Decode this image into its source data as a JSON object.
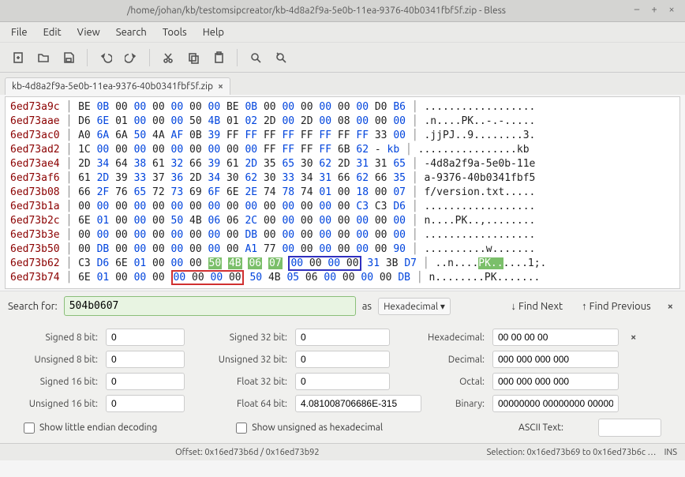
{
  "window": {
    "title": "/home/johan/kb/testomsipcreator/kb-4d8a2f9a-5e0b-11ea-9376-40b0341fbf5f.zip - Bless"
  },
  "menu": [
    "File",
    "Edit",
    "View",
    "Search",
    "Tools",
    "Help"
  ],
  "tab": {
    "label": "kb-4d8a2f9a-5e0b-11ea-9376-40b0341fbf5f.zip"
  },
  "hex": {
    "rows": [
      {
        "off": "6ed73a9c",
        "bytes": [
          "BE",
          "0B",
          "00",
          "00",
          "00",
          "00",
          "00",
          "00",
          "BE",
          "0B",
          "00",
          "00",
          "00",
          "00",
          "00",
          "00",
          "D0",
          "B6"
        ],
        "ascii": ".................."
      },
      {
        "off": "6ed73aae",
        "bytes": [
          "D6",
          "6E",
          "01",
          "00",
          "00",
          "00",
          "50",
          "4B",
          "01",
          "02",
          "2D",
          "00",
          "2D",
          "00",
          "08",
          "00",
          "00",
          "00"
        ],
        "ascii": ".n....PK..-.-....."
      },
      {
        "off": "6ed73ac0",
        "bytes": [
          "A0",
          "6A",
          "6A",
          "50",
          "4A",
          "AF",
          "0B",
          "39",
          "FF",
          "FF",
          "FF",
          "FF",
          "FF",
          "FF",
          "FF",
          "FF",
          "33",
          "00"
        ],
        "ascii": ".jjPJ..9........3."
      },
      {
        "off": "6ed73ad2",
        "bytes": [
          "1C",
          "00",
          "00",
          "00",
          "00",
          "00",
          "00",
          "00",
          "00",
          "00",
          "FF",
          "FF",
          "FF",
          "FF",
          "6B",
          "62",
          "-",
          "kb"
        ],
        "ascii": "................kb"
      },
      {
        "off": "6ed73ae4",
        "bytes": [
          "2D",
          "34",
          "64",
          "38",
          "61",
          "32",
          "66",
          "39",
          "61",
          "2D",
          "35",
          "65",
          "30",
          "62",
          "2D",
          "31",
          "31",
          "65"
        ],
        "ascii": "-4d8a2f9a-5e0b-11e"
      },
      {
        "off": "6ed73af6",
        "bytes": [
          "61",
          "2D",
          "39",
          "33",
          "37",
          "36",
          "2D",
          "34",
          "30",
          "62",
          "30",
          "33",
          "34",
          "31",
          "66",
          "62",
          "66",
          "35"
        ],
        "ascii": "a-9376-40b0341fbf5"
      },
      {
        "off": "6ed73b08",
        "bytes": [
          "66",
          "2F",
          "76",
          "65",
          "72",
          "73",
          "69",
          "6F",
          "6E",
          "2E",
          "74",
          "78",
          "74",
          "01",
          "00",
          "18",
          "00",
          "07"
        ],
        "ascii": "f/version.txt....."
      },
      {
        "off": "6ed73b1a",
        "bytes": [
          "00",
          "00",
          "00",
          "00",
          "00",
          "00",
          "00",
          "00",
          "00",
          "00",
          "00",
          "00",
          "00",
          "00",
          "00",
          "C3",
          "C3",
          "D6"
        ],
        "ascii": ".................."
      },
      {
        "off": "6ed73b2c",
        "bytes": [
          "6E",
          "01",
          "00",
          "00",
          "00",
          "50",
          "4B",
          "06",
          "06",
          "2C",
          "00",
          "00",
          "00",
          "00",
          "00",
          "00",
          "00",
          "00"
        ],
        "ascii": "n....PK..,........"
      },
      {
        "off": "6ed73b3e",
        "bytes": [
          "00",
          "00",
          "00",
          "00",
          "00",
          "00",
          "00",
          "00",
          "00",
          "DB",
          "00",
          "00",
          "00",
          "00",
          "00",
          "00",
          "00",
          "00"
        ],
        "ascii": ".................."
      },
      {
        "off": "6ed73b50",
        "bytes": [
          "00",
          "DB",
          "00",
          "00",
          "00",
          "00",
          "00",
          "00",
          "00",
          "A1",
          "77",
          "00",
          "00",
          "00",
          "00",
          "00",
          "00",
          "90"
        ],
        "ascii": "..........w......."
      },
      {
        "off": "6ed73b62",
        "bytes": [
          "C3",
          "D6",
          "6E",
          "01",
          "00",
          "00",
          "00",
          "50",
          "4B",
          "06",
          "07",
          "00",
          "00",
          "00",
          "00",
          "31",
          "3B",
          "D7"
        ],
        "ascii": "..n....PK......1;."
      },
      {
        "off": "6ed73b74",
        "bytes": [
          "6E",
          "01",
          "00",
          "00",
          "00",
          "00",
          "00",
          "00",
          "00",
          "50",
          "4B",
          "05",
          "06",
          "00",
          "00",
          "00",
          "00",
          "DB"
        ],
        "ascii": "n........PK......."
      }
    ]
  },
  "search": {
    "label": "Search for:",
    "value": "504b0607",
    "as": "as",
    "mode": "Hexadecimal",
    "find_next": "Find Next",
    "find_prev": "Find Previous"
  },
  "fields": {
    "s8_label": "Signed 8 bit:",
    "s8": "0",
    "u8_label": "Unsigned 8 bit:",
    "u8": "0",
    "s16_label": "Signed 16 bit:",
    "s16": "0",
    "u16_label": "Unsigned 16 bit:",
    "u16": "0",
    "s32_label": "Signed 32 bit:",
    "s32": "0",
    "u32_label": "Unsigned 32 bit:",
    "u32": "0",
    "f32_label": "Float 32 bit:",
    "f32": "0",
    "f64_label": "Float 64 bit:",
    "f64": "4.081008706686E-315",
    "hex_label": "Hexadecimal:",
    "hex": "00 00 00 00",
    "dec_label": "Decimal:",
    "dec": "000 000 000 000",
    "oct_label": "Octal:",
    "oct": "000 000 000 000",
    "bin_label": "Binary:",
    "bin": "00000000 00000000 00000",
    "ascii_label": "ASCII Text:",
    "ascii": ""
  },
  "checks": {
    "little_endian": "Show little endian decoding",
    "unsigned_hex": "Show unsigned as hexadecimal"
  },
  "status": {
    "offset": "Offset: 0x16ed73b6d / 0x16ed73b92",
    "selection": "Selection: 0x16ed73b69 to 0x16ed73b6c …",
    "mode": "INS"
  }
}
